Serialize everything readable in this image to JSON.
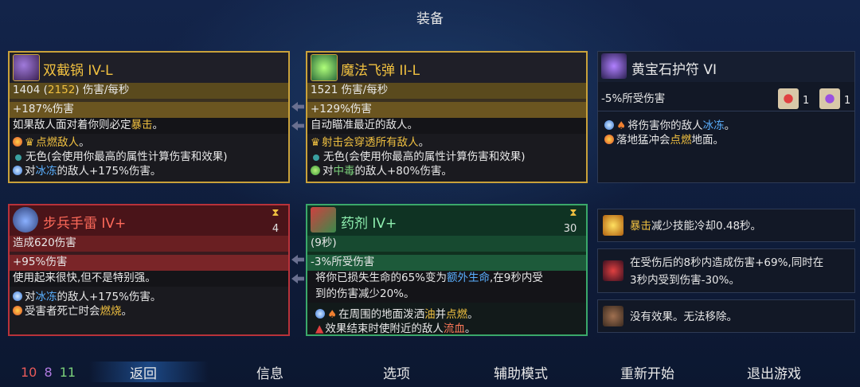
{
  "title": "装备",
  "weapons": [
    {
      "name": "双截锅 IV-L",
      "dps_base": "1404",
      "dps_boost": "2152",
      "dps_unit": "伤害/每秒",
      "damage": "+187%伤害",
      "description_pre": "如果敌人面对着你则必定",
      "description_hl": "暴击",
      "description_post": "。",
      "bonuses": [
        {
          "icon": "fire-icon",
          "crown": true,
          "hl": "点燃敌人",
          "rest": "。",
          "hl_color": "y"
        },
        {
          "icon": "gem-icon",
          "text": "无色(会使用你最高的属性计算伤害和效果)"
        },
        {
          "icon": "ice-icon",
          "pre": "对",
          "hl": "冰冻",
          "rest": "的敌人+175%伤害。",
          "hl_color": "b"
        }
      ]
    },
    {
      "name": "魔法飞弹 II-L",
      "dps": "1521 伤害/每秒",
      "damage": "+129%伤害",
      "description": "自动瞄准最近的敌人。",
      "bonuses": [
        {
          "icon": "crown-icon",
          "crown": true,
          "hl": "射击会穿透所有敌人",
          "rest": "。",
          "hl_color": "y"
        },
        {
          "icon": "gem-icon",
          "text": "无色(会使用你最高的属性计算伤害和效果)"
        },
        {
          "icon": "poison-icon",
          "pre": "对",
          "hl": "中毒",
          "rest": "的敌人+80%伤害。",
          "hl_color": "g"
        }
      ]
    }
  ],
  "amulet": {
    "name": "黄宝石护符 VI",
    "stat": "-5%所受伤害",
    "scroll1_count": "1",
    "scroll2_count": "1",
    "lines": [
      {
        "icon": "ice-icon",
        "pre": "将伤害你的敌人",
        "hl": "冰冻",
        "rest": "。",
        "hl_color": "b"
      },
      {
        "icon": "fire-icon",
        "pre": "落地猛冲会",
        "hl": "点燃",
        "rest": "地面。",
        "hl_color": "y"
      }
    ]
  },
  "skills": [
    {
      "name": "步兵手雷 IV+",
      "cooldown": "4",
      "stat1": "造成620伤害",
      "stat2": "+95%伤害",
      "description": "使用起来很快,但不是特别强。",
      "bonuses": [
        {
          "icon": "ice-icon",
          "pre": "对",
          "hl": "冰冻",
          "rest": "的敌人+175%伤害。",
          "hl_color": "b"
        },
        {
          "icon": "fire-icon",
          "pre": "受害者死亡时会",
          "hl": "燃烧",
          "rest": "。",
          "hl_color": "y"
        }
      ]
    },
    {
      "name": "药剂 IV+",
      "cooldown": "30",
      "stat1": "(9秒)",
      "stat2": "-3%所受伤害",
      "desc_line1_pre": "将你已损失生命的65%变为",
      "desc_line1_hl": "额外生命",
      "desc_line1_post": ",在9秒内受",
      "desc_line2": "到的伤害减少20%。",
      "bonuses": [
        {
          "icon": "oil-icon",
          "pre": "在周围的地面泼洒",
          "hl": "油",
          "mid": "并",
          "hl2": "点燃",
          "rest": "。"
        },
        {
          "icon": "bleed-icon",
          "pre": "效果结束时使附近的敌人",
          "hl": "流血",
          "rest": "。"
        }
      ]
    }
  ],
  "mutations": [
    {
      "icon": "crit-icon",
      "hl": "暴击",
      "rest": "减少技能冷却0.48秒。"
    },
    {
      "icon": "rage-icon",
      "line1": "在受伤后的8秒内造成伤害+69%,同时在",
      "line2": "3秒内受到伤害-30%。"
    },
    {
      "icon": "locked-icon",
      "text": "没有效果。无法移除。"
    }
  ],
  "stats": {
    "brutality": "10",
    "tactics": "8",
    "survival": "11"
  },
  "stat_colors": {
    "brutality": "#e85a5a",
    "tactics": "#b07ae0",
    "survival": "#7ad07a"
  },
  "nav": {
    "back": "返回",
    "info": "信息",
    "options": "选项",
    "assist": "辅助模式",
    "restart": "重新开始",
    "quit": "退出游戏"
  }
}
